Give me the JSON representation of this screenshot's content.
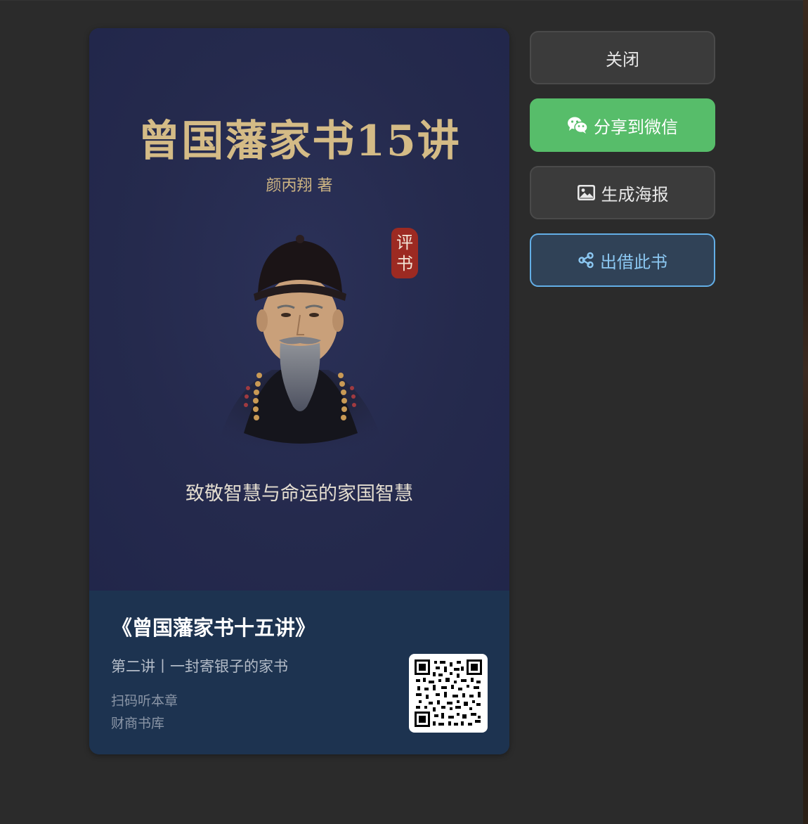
{
  "cover": {
    "title": "曾国藩家书15讲",
    "author": "颜丙翔 著",
    "seal": "评书",
    "slogan": "致敬智慧与命运的家国智慧"
  },
  "card": {
    "book_title": "《曾国藩家书十五讲》",
    "chapter": "第二讲丨一封寄银子的家书",
    "scan_hint": "扫码听本章",
    "publisher": "财商书库"
  },
  "actions": {
    "close_label": "关闭",
    "wechat_label": "分享到微信",
    "poster_label": "生成海报",
    "lend_label": "出借此书"
  },
  "icons": {
    "wechat": "wechat-icon",
    "poster": "image-icon",
    "lend": "share-nodes-icon"
  },
  "colors": {
    "background": "#2b2b2b",
    "cover_bg": "#252a4d",
    "cover_gold": "#d4bb86",
    "info_bg": "#1d3350",
    "wechat_green": "#57bd6a",
    "lend_border": "#63aee6",
    "lend_text": "#8cc8f2"
  }
}
